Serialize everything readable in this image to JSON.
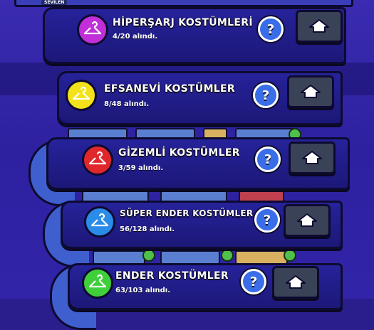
{
  "top_label": "SEVILEN",
  "categories": [
    {
      "title": "HİPERŞARJ KOSTÜMLERİ",
      "count": "4/20 alındı.",
      "color": "#c02fd8",
      "help": "?"
    },
    {
      "title": "EFSANEVİ KOSTÜMLER",
      "count": "8/48 alındı.",
      "color": "#f3e21a",
      "help": "?"
    },
    {
      "title": "GİZEMLİ KOSTÜMLER",
      "count": "3/59 alındı.",
      "color": "#e0282c",
      "help": "?"
    },
    {
      "title": "SÜPER ENDER KOSTÜMLER",
      "count": "56/128 alındı.",
      "color": "#2a8ce8",
      "help": "?"
    },
    {
      "title": "ENDER KOSTÜMLER",
      "count": "63/103 alındı.",
      "color": "#3fcf3a",
      "help": "?"
    }
  ],
  "icons": {
    "badge": "hanger-icon",
    "help": "question-icon",
    "home": "home-icon"
  }
}
